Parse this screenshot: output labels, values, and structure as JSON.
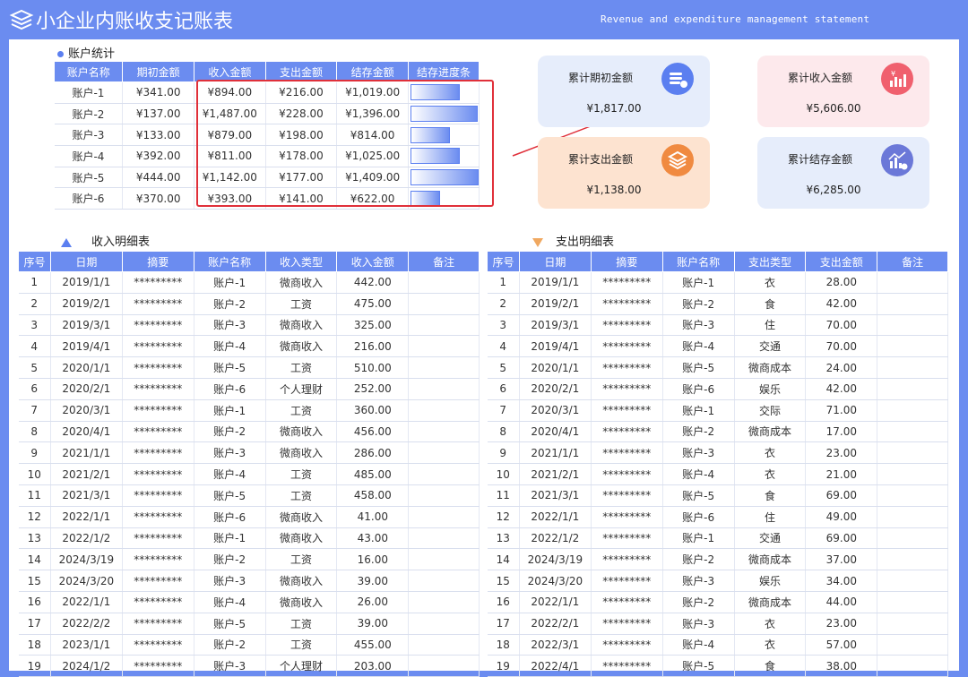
{
  "header": {
    "title": "小企业内账收支记账表",
    "subtitle": "Revenue and expenditure management statement"
  },
  "account_section": {
    "title": "账户统计",
    "columns": [
      "账户名称",
      "期初金额",
      "收入金额",
      "支出金额",
      "结存金额",
      "结存进度条"
    ],
    "rows": [
      {
        "name": "账户-1",
        "opening": "¥341.00",
        "income": "¥894.00",
        "expense": "¥216.00",
        "balance": "¥1,019.00",
        "progress": 0.72
      },
      {
        "name": "账户-2",
        "opening": "¥137.00",
        "income": "¥1,487.00",
        "expense": "¥228.00",
        "balance": "¥1,396.00",
        "progress": 0.99
      },
      {
        "name": "账户-3",
        "opening": "¥133.00",
        "income": "¥879.00",
        "expense": "¥198.00",
        "balance": "¥814.00",
        "progress": 0.58
      },
      {
        "name": "账户-4",
        "opening": "¥392.00",
        "income": "¥811.00",
        "expense": "¥178.00",
        "balance": "¥1,025.00",
        "progress": 0.73
      },
      {
        "name": "账户-5",
        "opening": "¥444.00",
        "income": "¥1,142.00",
        "expense": "¥177.00",
        "balance": "¥1,409.00",
        "progress": 1.0
      },
      {
        "name": "账户-6",
        "opening": "¥370.00",
        "income": "¥393.00",
        "expense": "¥141.00",
        "balance": "¥622.00",
        "progress": 0.44
      }
    ]
  },
  "summary_cards": [
    {
      "label": "累计期初金额",
      "value": "¥1,817.00",
      "bg": "#e6edfb",
      "icon_color": "#5b7ff0",
      "icon": "coins-icon"
    },
    {
      "label": "累计收入金额",
      "value": "¥5,606.00",
      "bg": "#fde9ec",
      "icon_color": "#f0606e",
      "icon": "income-chart-icon"
    },
    {
      "label": "累计支出金额",
      "value": "¥1,138.00",
      "bg": "#fde3d0",
      "icon_color": "#f08a40",
      "icon": "layers-icon"
    },
    {
      "label": "累计结存金额",
      "value": "¥6,285.00",
      "bg": "#e6edfb",
      "icon_color": "#6b78d8",
      "icon": "balance-chart-icon"
    }
  ],
  "income_section": {
    "title": "收入明细表",
    "columns": [
      "序号",
      "日期",
      "摘要",
      "账户名称",
      "收入类型",
      "收入金额",
      "备注"
    ],
    "rows": [
      [
        "1",
        "2019/1/1",
        "*********",
        "账户-1",
        "微商收入",
        "442.00",
        ""
      ],
      [
        "2",
        "2019/2/1",
        "*********",
        "账户-2",
        "工资",
        "475.00",
        ""
      ],
      [
        "3",
        "2019/3/1",
        "*********",
        "账户-3",
        "微商收入",
        "325.00",
        ""
      ],
      [
        "4",
        "2019/4/1",
        "*********",
        "账户-4",
        "微商收入",
        "216.00",
        ""
      ],
      [
        "5",
        "2020/1/1",
        "*********",
        "账户-5",
        "工资",
        "510.00",
        ""
      ],
      [
        "6",
        "2020/2/1",
        "*********",
        "账户-6",
        "个人理财",
        "252.00",
        ""
      ],
      [
        "7",
        "2020/3/1",
        "*********",
        "账户-1",
        "工资",
        "360.00",
        ""
      ],
      [
        "8",
        "2020/4/1",
        "*********",
        "账户-2",
        "微商收入",
        "456.00",
        ""
      ],
      [
        "9",
        "2021/1/1",
        "*********",
        "账户-3",
        "微商收入",
        "286.00",
        ""
      ],
      [
        "10",
        "2021/2/1",
        "*********",
        "账户-4",
        "工资",
        "485.00",
        ""
      ],
      [
        "11",
        "2021/3/1",
        "*********",
        "账户-5",
        "工资",
        "458.00",
        ""
      ],
      [
        "12",
        "2022/1/1",
        "*********",
        "账户-6",
        "微商收入",
        "41.00",
        ""
      ],
      [
        "13",
        "2022/1/2",
        "*********",
        "账户-1",
        "微商收入",
        "43.00",
        ""
      ],
      [
        "14",
        "2024/3/19",
        "*********",
        "账户-2",
        "工资",
        "16.00",
        ""
      ],
      [
        "15",
        "2024/3/20",
        "*********",
        "账户-3",
        "微商收入",
        "39.00",
        ""
      ],
      [
        "16",
        "2022/1/1",
        "*********",
        "账户-4",
        "微商收入",
        "26.00",
        ""
      ],
      [
        "17",
        "2022/2/2",
        "*********",
        "账户-5",
        "工资",
        "39.00",
        ""
      ],
      [
        "18",
        "2023/1/1",
        "*********",
        "账户-2",
        "工资",
        "455.00",
        ""
      ],
      [
        "19",
        "2024/1/2",
        "*********",
        "账户-3",
        "个人理财",
        "203.00",
        ""
      ]
    ]
  },
  "expense_section": {
    "title": "支出明细表",
    "columns": [
      "序号",
      "日期",
      "摘要",
      "账户名称",
      "支出类型",
      "支出金额",
      "备注"
    ],
    "rows": [
      [
        "1",
        "2019/1/1",
        "*********",
        "账户-1",
        "衣",
        "28.00",
        ""
      ],
      [
        "2",
        "2019/2/1",
        "*********",
        "账户-2",
        "食",
        "42.00",
        ""
      ],
      [
        "3",
        "2019/3/1",
        "*********",
        "账户-3",
        "住",
        "70.00",
        ""
      ],
      [
        "4",
        "2019/4/1",
        "*********",
        "账户-4",
        "交通",
        "70.00",
        ""
      ],
      [
        "5",
        "2020/1/1",
        "*********",
        "账户-5",
        "微商成本",
        "24.00",
        ""
      ],
      [
        "6",
        "2020/2/1",
        "*********",
        "账户-6",
        "娱乐",
        "42.00",
        ""
      ],
      [
        "7",
        "2020/3/1",
        "*********",
        "账户-1",
        "交际",
        "71.00",
        ""
      ],
      [
        "8",
        "2020/4/1",
        "*********",
        "账户-2",
        "微商成本",
        "17.00",
        ""
      ],
      [
        "9",
        "2021/1/1",
        "*********",
        "账户-3",
        "衣",
        "23.00",
        ""
      ],
      [
        "10",
        "2021/2/1",
        "*********",
        "账户-4",
        "衣",
        "21.00",
        ""
      ],
      [
        "11",
        "2021/3/1",
        "*********",
        "账户-5",
        "食",
        "69.00",
        ""
      ],
      [
        "12",
        "2022/1/1",
        "*********",
        "账户-6",
        "住",
        "49.00",
        ""
      ],
      [
        "13",
        "2022/1/2",
        "*********",
        "账户-1",
        "交通",
        "69.00",
        ""
      ],
      [
        "14",
        "2024/3/19",
        "*********",
        "账户-2",
        "微商成本",
        "37.00",
        ""
      ],
      [
        "15",
        "2024/3/20",
        "*********",
        "账户-3",
        "娱乐",
        "34.00",
        ""
      ],
      [
        "16",
        "2022/1/1",
        "*********",
        "账户-2",
        "微商成本",
        "44.00",
        ""
      ],
      [
        "17",
        "2022/2/1",
        "*********",
        "账户-3",
        "衣",
        "23.00",
        ""
      ],
      [
        "18",
        "2022/3/1",
        "*********",
        "账户-4",
        "衣",
        "57.00",
        ""
      ],
      [
        "19",
        "2022/4/1",
        "*********",
        "账户-5",
        "食",
        "38.00",
        ""
      ]
    ]
  },
  "colors": {
    "header_blue": "#6b8cf0",
    "highlight_red": "#e0303a"
  }
}
